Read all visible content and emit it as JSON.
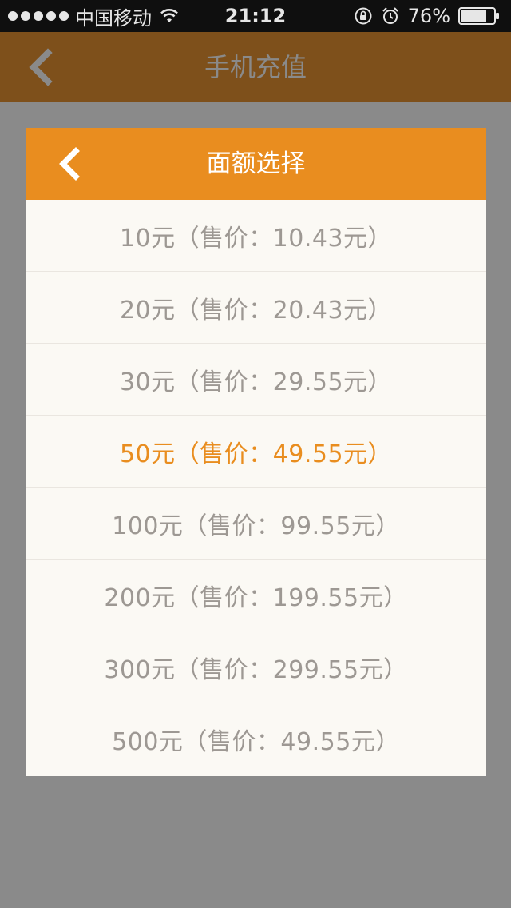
{
  "status_bar": {
    "carrier": "中国移动",
    "time": "21:12",
    "battery": "76%",
    "icons": [
      "signal-dots-icon",
      "wifi-icon",
      "rotation-lock-icon",
      "alarm-icon",
      "battery-icon"
    ]
  },
  "nav": {
    "title": "手机充值",
    "back_icon": "chevron-left-icon"
  },
  "dialog": {
    "title": "面额选择",
    "back_icon": "chevron-left-icon",
    "selected_index": 3,
    "options": [
      {
        "label": "10元（售价：10.43元）"
      },
      {
        "label": "20元（售价：20.43元）"
      },
      {
        "label": "30元（售价：29.55元）"
      },
      {
        "label": "50元（售价：49.55元）"
      },
      {
        "label": "100元（售价：99.55元）"
      },
      {
        "label": "200元（售价：199.55元）"
      },
      {
        "label": "300元（售价：299.55元）"
      },
      {
        "label": "500元（售价：49.55元）"
      }
    ]
  },
  "colors": {
    "accent": "#e98d1f",
    "nav_bar": "#7e501b",
    "option_text": "#9d9893",
    "overlay": "#8a8a8a"
  }
}
